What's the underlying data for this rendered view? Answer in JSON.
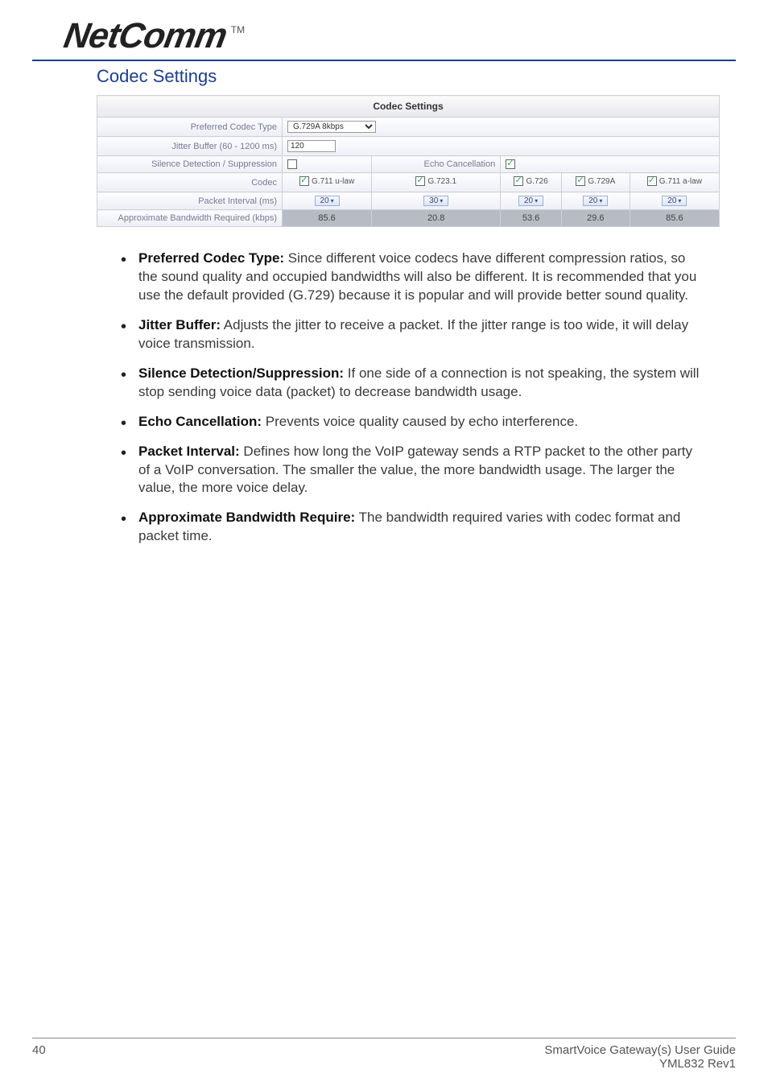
{
  "logo": {
    "text": "NetComm",
    "tm": "TM"
  },
  "section_title": "Codec Settings",
  "table": {
    "header": "Codec Settings",
    "rows": {
      "preferred": {
        "label": "Preferred Codec Type",
        "value": "G.729A 8kbps"
      },
      "jitter": {
        "label": "Jitter Buffer (60 - 1200 ms)",
        "value": "120"
      },
      "silence": {
        "label": "Silence Detection / Suppression",
        "checked": false
      },
      "echo": {
        "label": "Echo Cancellation",
        "checked": true
      },
      "codecs": {
        "label": "Codec",
        "items": [
          {
            "name": "G.711 u-law",
            "checked": true
          },
          {
            "name": "G.723.1",
            "checked": true
          },
          {
            "name": "G.726",
            "checked": true
          },
          {
            "name": "G.729A",
            "checked": true
          },
          {
            "name": "G.711 a-law",
            "checked": true
          }
        ]
      },
      "packet": {
        "label": "Packet Interval (ms)",
        "values": [
          "20",
          "30",
          "20",
          "20",
          "20"
        ]
      },
      "bandwidth": {
        "label": "Approximate Bandwidth Required (kbps)",
        "values": [
          "85.6",
          "20.8",
          "53.6",
          "29.6",
          "85.6"
        ]
      }
    }
  },
  "bullets": [
    {
      "term": "Preferred Codec Type:",
      "text": " Since different voice codecs have different compression ratios, so the sound quality and occupied bandwidths will also be different. It is recommended that you use the default provided (G.729) because it is popular and will provide better sound quality."
    },
    {
      "term": "Jitter Buffer:",
      "text": " Adjusts the jitter to receive a packet. If the jitter range is too wide, it will delay voice transmission."
    },
    {
      "term": "Silence Detection/Suppression:",
      "text": " If one side of a connection is not speaking, the system will stop sending voice data (packet) to decrease bandwidth usage."
    },
    {
      "term": "Echo Cancellation:",
      "text": " Prevents voice quality caused by echo interference."
    },
    {
      "term": "Packet Interval:",
      "text": " Defines how long the VoIP gateway sends a RTP packet to the other party of a VoIP conversation. The smaller the value, the more bandwidth usage. The larger the value, the more voice delay."
    },
    {
      "term": "Approximate Bandwidth Require:",
      "text": " The bandwidth required varies with codec format and packet time."
    }
  ],
  "footer": {
    "page": "40",
    "guide": "SmartVoice Gateway(s) User Guide",
    "rev": "YML832 Rev1"
  }
}
